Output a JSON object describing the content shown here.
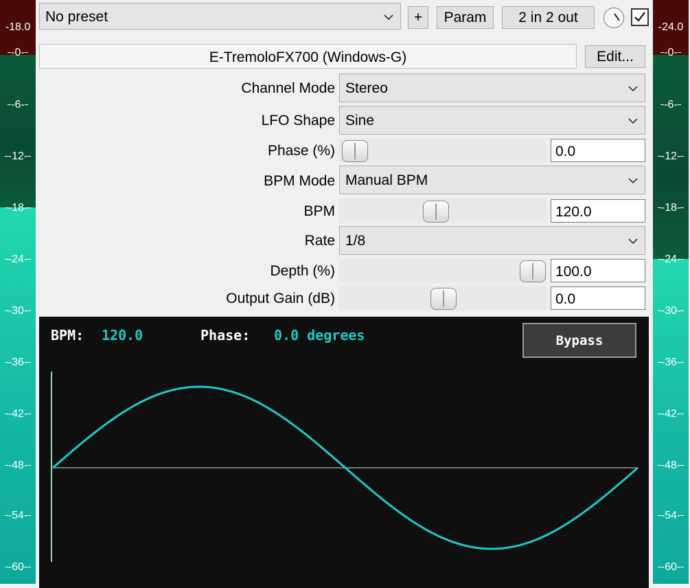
{
  "meter_left": {
    "peak": "-18.0",
    "ticks": [
      "-0-",
      "-6-",
      "-12-",
      "-18-",
      "-24-",
      "-30-",
      "-36-",
      "-42-",
      "-48-",
      "-54-",
      "-60-"
    ]
  },
  "meter_right": {
    "peak": "-24.0",
    "ticks": [
      "-0-",
      "-6-",
      "-12-",
      "-18-",
      "-24-",
      "-30-",
      "-36-",
      "-42-",
      "-48-",
      "-54-",
      "-60-"
    ]
  },
  "toolbar": {
    "preset": "No preset",
    "add": "+",
    "param": "Param",
    "routing": "2 in 2 out"
  },
  "plugin": {
    "name": "E-TremoloFX700 (Windows-G)",
    "edit": "Edit..."
  },
  "params": {
    "channel_mode": {
      "label": "Channel Mode",
      "value": "Stereo"
    },
    "lfo_shape": {
      "label": "LFO Shape",
      "value": "Sine"
    },
    "phase": {
      "label": "Phase (%)",
      "value": "0.0"
    },
    "bpm_mode": {
      "label": "BPM Mode",
      "value": "Manual BPM"
    },
    "bpm": {
      "label": "BPM",
      "value": "120.0"
    },
    "rate": {
      "label": "Rate",
      "value": "1/8"
    },
    "depth": {
      "label": "Depth (%)",
      "value": "100.0"
    },
    "output_gain": {
      "label": "Output Gain (dB)",
      "value": "0.0"
    }
  },
  "display": {
    "bpm_label": "BPM:",
    "bpm_value": "120.0",
    "phase_label": "Phase:",
    "phase_value": "0.0 degrees",
    "bypass": "Bypass"
  },
  "colors": {
    "waveform": "#1ec8c8",
    "display_bg": "#0f0f0f",
    "meter_dark": "#0a4a34",
    "meter_light": "#15b8a4",
    "meter_peak": "#4a0a06"
  }
}
